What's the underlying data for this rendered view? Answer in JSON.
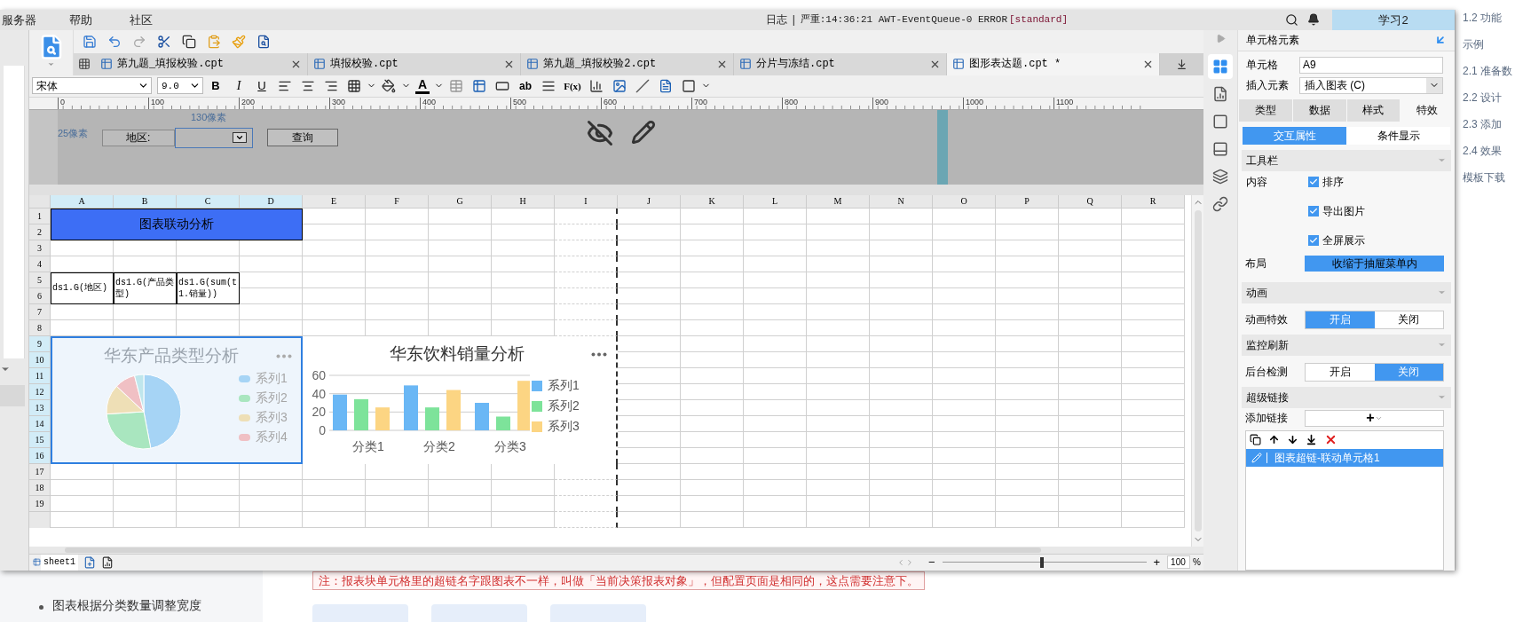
{
  "menu": [
    {
      "label": "服务器"
    },
    {
      "label": "帮助"
    },
    {
      "label": "社区"
    }
  ],
  "log": {
    "label": "日志",
    "separator": "|",
    "message": "严重:14:36:21 AWT-EventQueue-0 ERROR",
    "tag": "[standard]"
  },
  "user": "学习2",
  "tabs": [
    {
      "label": "第九题_填报校验.cpt",
      "selected": false
    },
    {
      "label": "填报校验.cpt",
      "selected": false
    },
    {
      "label": "第九题_填报校验2.cpt",
      "selected": false
    },
    {
      "label": "分片与冻结.cpt",
      "selected": false
    },
    {
      "label": "图形表达题.cpt *",
      "selected": true
    }
  ],
  "format_toolbar": {
    "font": "宋体",
    "size": "9.0",
    "bold": "B",
    "italic": "I",
    "underline": "U",
    "font_color": "A",
    "text": "ab",
    "formula": "F(x)"
  },
  "ruler": [
    "0",
    "100",
    "200",
    "300",
    "400",
    "500",
    "600",
    "700",
    "800",
    "900",
    "1000",
    "1100"
  ],
  "form": {
    "width_label": "130像素",
    "height_label": "25像素",
    "field_label": "地区:",
    "query_button": "查询"
  },
  "columns": [
    {
      "label": "A",
      "selected": true
    },
    {
      "label": "B",
      "selected": true
    },
    {
      "label": "C",
      "selected": true
    },
    {
      "label": "D",
      "selected": true
    },
    {
      "label": "E",
      "selected": false
    },
    {
      "label": "F",
      "selected": false
    },
    {
      "label": "G",
      "selected": false
    },
    {
      "label": "H",
      "selected": false
    },
    {
      "label": "I",
      "selected": false
    },
    {
      "label": "J",
      "selected": false
    },
    {
      "label": "K",
      "selected": false
    },
    {
      "label": "L",
      "selected": false
    },
    {
      "label": "M",
      "selected": false
    },
    {
      "label": "N",
      "selected": false
    },
    {
      "label": "O",
      "selected": false
    },
    {
      "label": "P",
      "selected": false
    },
    {
      "label": "Q",
      "selected": false
    },
    {
      "label": "R",
      "selected": false
    }
  ],
  "rows": [
    {
      "label": "1",
      "selected": false
    },
    {
      "label": "2",
      "selected": false
    },
    {
      "label": "3",
      "selected": false
    },
    {
      "label": "4",
      "selected": false
    },
    {
      "label": "5",
      "selected": false
    },
    {
      "label": "6",
      "selected": false
    },
    {
      "label": "7",
      "selected": false
    },
    {
      "label": "8",
      "selected": false
    },
    {
      "label": "9",
      "selected": true
    },
    {
      "label": "10",
      "selected": true
    },
    {
      "label": "11",
      "selected": true
    },
    {
      "label": "12",
      "selected": true
    },
    {
      "label": "13",
      "selected": true
    },
    {
      "label": "14",
      "selected": true
    },
    {
      "label": "15",
      "selected": true
    },
    {
      "label": "16",
      "selected": true
    },
    {
      "label": "17",
      "selected": false
    },
    {
      "label": "18",
      "selected": false
    },
    {
      "label": "19",
      "selected": false
    }
  ],
  "title_cell": "图表联动分析",
  "cells": [
    "ds1.G(地区)",
    "ds1.G(产品类型)",
    "ds1.G(sum(t1.销量))"
  ],
  "pie_chart": {
    "title": "华东产品类型分析",
    "selected": true,
    "legend": [
      {
        "label": "系列1",
        "color": "#a6d4f5"
      },
      {
        "label": "系列2",
        "color": "#a9e6bf"
      },
      {
        "label": "系列3",
        "color": "#eedfb6"
      },
      {
        "label": "系列4",
        "color": "#f0c0c4"
      }
    ]
  },
  "bar_chart": {
    "chart_data": {
      "type": "bar",
      "title": "华东饮料销量分析",
      "categories": [
        "分类1",
        "分类2",
        "分类3"
      ],
      "series": [
        {
          "name": "系列1",
          "color": "#6ab7f5",
          "values": [
            39,
            49,
            30
          ]
        },
        {
          "name": "系列2",
          "color": "#7de39a",
          "values": [
            34,
            25,
            15
          ]
        },
        {
          "name": "系列3",
          "color": "#fcd583",
          "values": [
            25,
            44,
            54
          ]
        }
      ],
      "ylim": [
        0,
        60
      ],
      "yticks": [
        0,
        20,
        40,
        60
      ]
    }
  },
  "sheet_tabs": [
    {
      "label": "sheet1",
      "selected": true
    }
  ],
  "zoom": {
    "minus": "−",
    "plus": "+",
    "value": "100",
    "unit": "%",
    "level": 0.49
  },
  "icon_strip": [
    {
      "selected": true
    },
    {
      "selected": false
    },
    {
      "selected": false
    },
    {
      "selected": false
    },
    {
      "selected": false
    },
    {
      "selected": false
    }
  ],
  "panel": {
    "title": "单元格元素",
    "cell_label": "单元格",
    "cell_value": "A9",
    "insert_label": "插入元素",
    "insert_value": "插入图表 (C)",
    "tabs": [
      {
        "label": "类型",
        "selected": false
      },
      {
        "label": "数据",
        "selected": false
      },
      {
        "label": "样式",
        "selected": false
      },
      {
        "label": "特效",
        "selected": true
      }
    ],
    "subtabs": [
      {
        "label": "交互属性",
        "selected": true
      },
      {
        "label": "条件显示",
        "selected": false
      }
    ],
    "toolbar_section": "工具栏",
    "content_label": "内容",
    "checks": [
      {
        "label": "排序",
        "checked": true
      },
      {
        "label": "导出图片",
        "checked": true
      },
      {
        "label": "全屏展示",
        "checked": true
      }
    ],
    "layout_label": "布局",
    "layout_value": "收缩于抽屉菜单内",
    "animation_section": "动画",
    "animation_label": "动画特效",
    "animation_options": [
      {
        "label": "开启",
        "selected": true
      },
      {
        "label": "关闭",
        "selected": false
      }
    ],
    "refresh_section": "监控刷新",
    "refresh_label": "后台检测",
    "refresh_options": [
      {
        "label": "开启",
        "selected": false
      },
      {
        "label": "关闭",
        "selected": true
      }
    ],
    "link_section": "超级链接",
    "add_link_label": "添加链接",
    "add_link_button": "+",
    "links": [
      {
        "label": "图表超链-联动单元格1",
        "selected": true
      }
    ]
  },
  "doc_toc": [
    "1.2 功能",
    "示例",
    "2.1 准备数",
    "2.2 设计",
    "2.3 添加",
    "2.4 效果",
    "模板下载"
  ],
  "doc": {
    "note": "注：报表块单元格里的超链名字跟图表不一样，叫做「当前决策报表对象」，但配置页面是相同的，这点需要注意下。",
    "bullet": "图表根据分类数量调整宽度"
  }
}
